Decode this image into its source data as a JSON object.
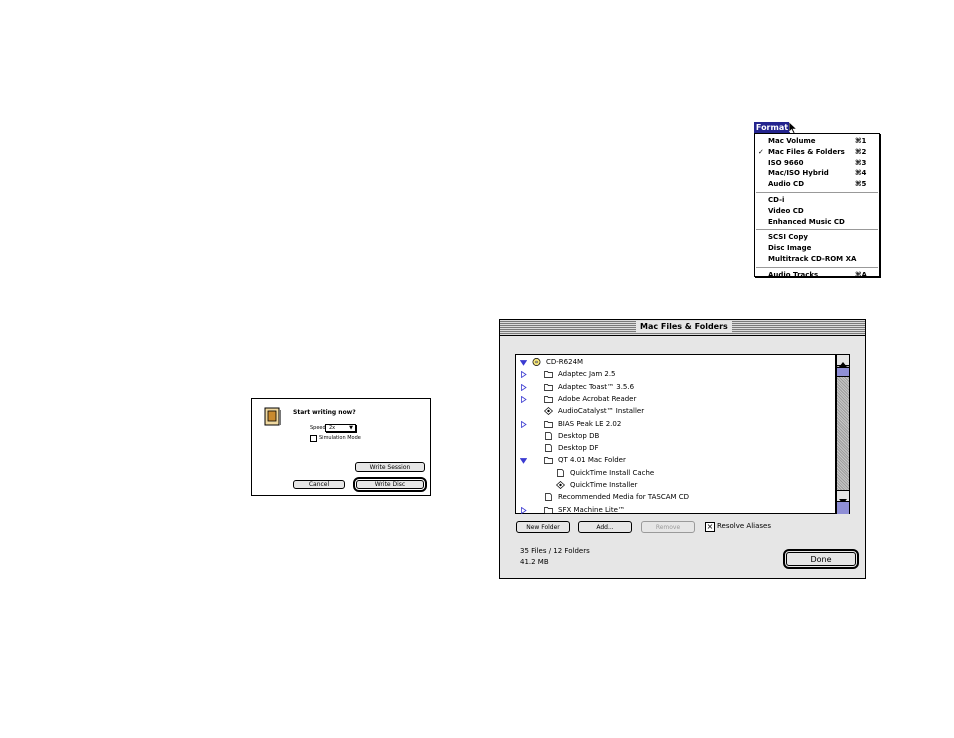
{
  "format_menu": {
    "title": "Format",
    "groups": [
      [
        {
          "label": "Mac Volume",
          "shortcut": "⌘1",
          "checked": false
        },
        {
          "label": "Mac Files & Folders",
          "shortcut": "⌘2",
          "checked": true
        },
        {
          "label": "ISO 9660",
          "shortcut": "⌘3",
          "checked": false
        },
        {
          "label": "Mac/ISO Hybrid",
          "shortcut": "⌘4",
          "checked": false
        },
        {
          "label": "Audio CD",
          "shortcut": "⌘5",
          "checked": false
        }
      ],
      [
        {
          "label": "CD-i",
          "shortcut": "",
          "checked": false
        },
        {
          "label": "Video CD",
          "shortcut": "",
          "checked": false
        },
        {
          "label": "Enhanced Music CD",
          "shortcut": "",
          "checked": false
        }
      ],
      [
        {
          "label": "SCSI Copy",
          "shortcut": "",
          "checked": false
        },
        {
          "label": "Disc Image",
          "shortcut": "",
          "checked": false
        },
        {
          "label": "Multitrack CD-ROM XA",
          "shortcut": "",
          "checked": false
        }
      ],
      [
        {
          "label": "Audio Tracks",
          "shortcut": "⌘A",
          "checked": false
        }
      ]
    ]
  },
  "write_dialog": {
    "prompt": "Start writing now?",
    "speed_label": "Speed:",
    "speed_value": "2x",
    "simulation_label": "Simulation Mode",
    "simulation_checked": false,
    "write_session_label": "Write Session",
    "cancel_label": "Cancel",
    "write_disc_label": "Write Disc"
  },
  "files_window": {
    "title": "Mac Files & Folders",
    "items": [
      {
        "name": "CD-R624M",
        "kind": "disc",
        "expander": "open",
        "level": 0
      },
      {
        "name": "Adaptec Jam 2.5",
        "kind": "folder",
        "expander": "closed",
        "level": 1
      },
      {
        "name": "Adaptec Toast™ 3.5.6",
        "kind": "folder",
        "expander": "closed",
        "level": 1
      },
      {
        "name": "Adobe Acrobat Reader",
        "kind": "folder",
        "expander": "closed",
        "level": 1
      },
      {
        "name": "AudioCatalyst™ Installer",
        "kind": "app",
        "expander": "none",
        "level": 1
      },
      {
        "name": "BIAS Peak LE 2.02",
        "kind": "folder",
        "expander": "closed",
        "level": 1
      },
      {
        "name": "Desktop DB",
        "kind": "file",
        "expander": "none",
        "level": 1
      },
      {
        "name": "Desktop DF",
        "kind": "file",
        "expander": "none",
        "level": 1
      },
      {
        "name": "QT 4.01 Mac Folder",
        "kind": "folder",
        "expander": "open",
        "level": 1
      },
      {
        "name": "QuickTime Install Cache",
        "kind": "file",
        "expander": "none",
        "level": 2
      },
      {
        "name": "QuickTime Installer",
        "kind": "app",
        "expander": "none",
        "level": 2
      },
      {
        "name": "Recommended Media for TASCAM CD",
        "kind": "file",
        "expander": "none",
        "level": 1
      },
      {
        "name": "SFX Machine Lite™",
        "kind": "folder",
        "expander": "closed",
        "level": 1
      }
    ],
    "new_folder_label": "New Folder",
    "add_label": "Add...",
    "remove_label": "Remove",
    "resolve_aliases_label": "Resolve Aliases",
    "resolve_aliases_checked": true,
    "files_count": "35 Files / 12 Folders",
    "size": "41.2 MB",
    "done_label": "Done"
  },
  "colors": {
    "menu_highlight": "#23238e",
    "window_gray": "#e6e6e6",
    "expander_blue": "#3b3bd1",
    "scroll_thumb": "#8f8fd6"
  }
}
